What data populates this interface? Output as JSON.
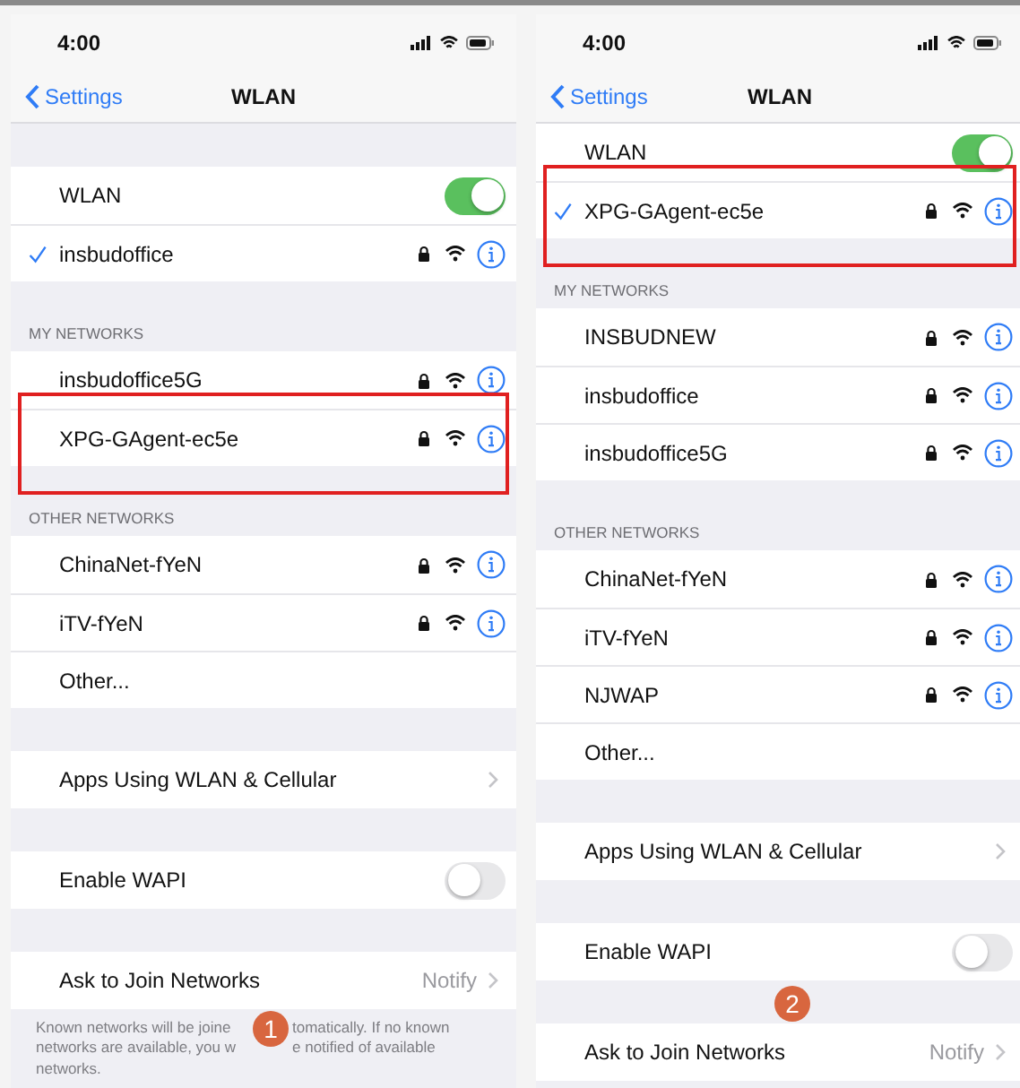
{
  "panels": [
    {
      "status_time": "4:00",
      "nav": {
        "back": "Settings",
        "title": "WLAN"
      },
      "sections": [
        {
          "rows": [
            {
              "kind": "toggle",
              "label": "WLAN",
              "on": true
            },
            {
              "kind": "network",
              "label": "insbudoffice",
              "connected": true,
              "highlighted": false
            }
          ]
        },
        {
          "header": "MY NETWORKS",
          "rows": [
            {
              "kind": "network",
              "label": "insbudoffice5G",
              "connected": false,
              "highlighted": false
            },
            {
              "kind": "network",
              "label": "XPG-GAgent-ec5e",
              "connected": false,
              "highlighted": true
            }
          ]
        },
        {
          "header": "OTHER NETWORKS",
          "rows": [
            {
              "kind": "network",
              "label": "ChinaNet-fYeN",
              "connected": false,
              "highlighted": false
            },
            {
              "kind": "network",
              "label": "iTV-fYeN",
              "connected": false,
              "highlighted": false
            },
            {
              "kind": "plain",
              "label": "Other..."
            }
          ]
        },
        {
          "rows": [
            {
              "kind": "link",
              "label": "Apps Using WLAN & Cellular"
            }
          ]
        },
        {
          "rows": [
            {
              "kind": "toggle",
              "label": "Enable WAPI",
              "on": false
            }
          ]
        },
        {
          "rows": [
            {
              "kind": "link",
              "label": "Ask to Join Networks",
              "value": "Notify"
            }
          ],
          "badge": "1",
          "footer": [
            [
              "Known networks will be joine",
              "tomatically. If no known"
            ],
            [
              "networks are available, you w",
              "e notified of available"
            ],
            [
              "networks."
            ]
          ]
        }
      ]
    },
    {
      "status_time": "4:00",
      "nav": {
        "back": "Settings",
        "title": "WLAN"
      },
      "sections": [
        {
          "rows": [
            {
              "kind": "toggle",
              "label": "WLAN",
              "on": true
            },
            {
              "kind": "network",
              "label": "XPG-GAgent-ec5e",
              "connected": true,
              "highlighted": true
            }
          ]
        },
        {
          "header": "MY NETWORKS",
          "rows": [
            {
              "kind": "network",
              "label": "INSBUDNEW",
              "connected": false,
              "highlighted": false
            },
            {
              "kind": "network",
              "label": "insbudoffice",
              "connected": false,
              "highlighted": false
            },
            {
              "kind": "network",
              "label": "insbudoffice5G",
              "connected": false,
              "highlighted": false
            }
          ]
        },
        {
          "header": "OTHER NETWORKS",
          "rows": [
            {
              "kind": "network",
              "label": "ChinaNet-fYeN",
              "connected": false,
              "highlighted": false
            },
            {
              "kind": "network",
              "label": "iTV-fYeN",
              "connected": false,
              "highlighted": false
            },
            {
              "kind": "network",
              "label": "NJWAP",
              "connected": false,
              "highlighted": false
            },
            {
              "kind": "plain",
              "label": "Other..."
            }
          ]
        },
        {
          "rows": [
            {
              "kind": "link",
              "label": "Apps Using WLAN & Cellular"
            }
          ]
        },
        {
          "rows": [
            {
              "kind": "toggle",
              "label": "Enable WAPI",
              "on": false
            }
          ]
        },
        {
          "rows": [
            {
              "kind": "link",
              "label": "Ask to Join Networks",
              "value": "Notify"
            }
          ],
          "badge": "2"
        }
      ]
    }
  ]
}
